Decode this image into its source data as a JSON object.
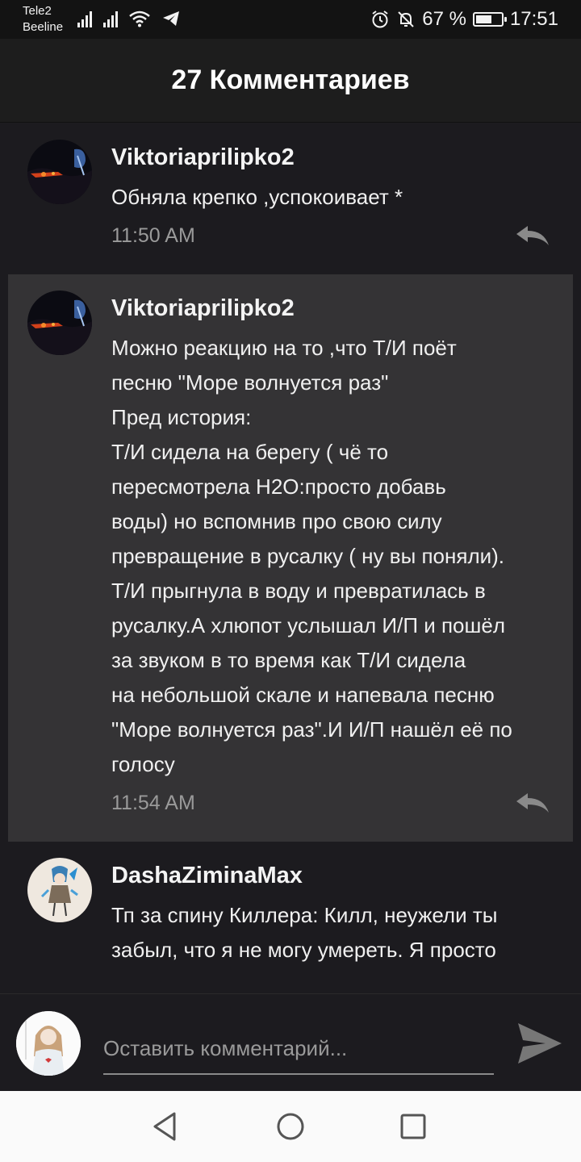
{
  "status": {
    "carrier1": "Tele2",
    "carrier2": "Beeline",
    "battery": "67 %",
    "battery_fraction": 0.67,
    "time": "17:51",
    "icons": [
      "signal-icon",
      "signal-icon",
      "wifi-icon",
      "telegram-icon",
      "alarm-icon",
      "mute-icon",
      "battery-icon"
    ]
  },
  "header": {
    "title": "27 Комментариев"
  },
  "comments": [
    {
      "author": "Viktoriaprilipko2",
      "text": "Обняла крепко ,успокоивает *",
      "time": "11:50 AM"
    },
    {
      "author": "Viktoriaprilipko2",
      "text": "Можно реакцию на то ,что Т/И  поёт\nпесню \"Море волнуется раз\"\nПред история:\nТ/И сидела на берегу ( чё то\nпересмотрела H2O:просто добавь\nводы) но вспомнив про свою силу\nпревращение в русалку ( ну вы поняли).\nТ/И прыгнула в воду и превратилась в\nрусалку.А хлюпот услышал И/П и пошёл\nза звуком в то время как Т/И сидела\nна небольшой скале и напевала песню\n\"Море волнуется раз\".И И/П нашёл её по\nголосу",
      "time": "11:54 AM"
    },
    {
      "author": "DashaZiminaMax",
      "text": "Тп за спину Киллера: Килл, неужели ты\nзабыл, что я не могу умереть. Я просто",
      "time": ""
    }
  ],
  "composer": {
    "placeholder": "Оставить комментарий..."
  },
  "colors": {
    "background": "#1c1b1f",
    "highlight": "#343335",
    "header": "#1d1d1d",
    "timestamp": "#9a9a9a",
    "navbar": "#fafafa"
  }
}
